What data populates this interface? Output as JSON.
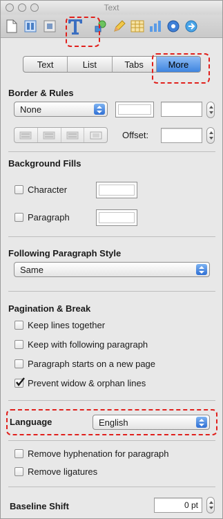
{
  "window": {
    "title": "Text"
  },
  "toolbar": {
    "icons": [
      "document-icon",
      "layout-icon",
      "wrap-icon",
      "text-icon",
      "shape-icon",
      "pencil-icon",
      "table-icon",
      "chart-icon",
      "metrics-icon",
      "link-icon"
    ],
    "selected": "text-icon"
  },
  "tabs": [
    {
      "label": "Text",
      "active": false
    },
    {
      "label": "List",
      "active": false
    },
    {
      "label": "Tabs",
      "active": false
    },
    {
      "label": "More",
      "active": true
    }
  ],
  "border_rules": {
    "title": "Border & Rules",
    "style_value": "None",
    "offset_label": "Offset:"
  },
  "background_fills": {
    "title": "Background Fills",
    "character_label": "Character",
    "paragraph_label": "Paragraph"
  },
  "following_style": {
    "title": "Following Paragraph Style",
    "value": "Same"
  },
  "pagination": {
    "title": "Pagination & Break",
    "options": [
      {
        "label": "Keep lines together",
        "checked": false
      },
      {
        "label": "Keep with following paragraph",
        "checked": false
      },
      {
        "label": "Paragraph starts on a new page",
        "checked": false
      },
      {
        "label": "Prevent widow & orphan lines",
        "checked": true
      }
    ]
  },
  "language": {
    "label": "Language",
    "value": "English"
  },
  "hyphenation": {
    "options": [
      {
        "label": "Remove hyphenation for paragraph",
        "checked": false
      },
      {
        "label": "Remove ligatures",
        "checked": false
      }
    ]
  },
  "baseline": {
    "label": "Baseline Shift",
    "value": "0 pt"
  },
  "colors": {
    "highlight": "#e0201c",
    "accent": "#3f85e0"
  }
}
